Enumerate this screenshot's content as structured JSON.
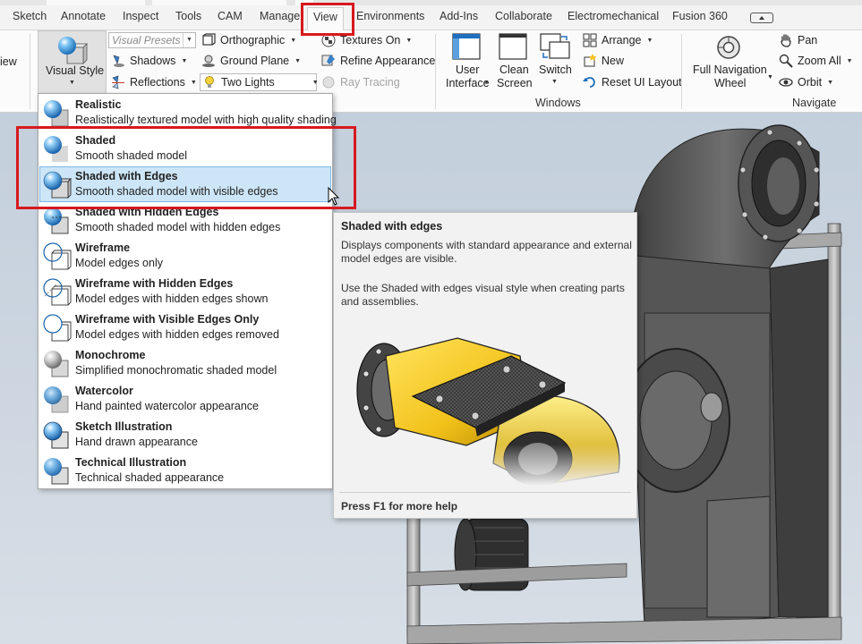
{
  "tabs": [
    "Sketch",
    "Annotate",
    "Inspect",
    "Tools",
    "CAM",
    "Manage",
    "View",
    "Environments",
    "Add-Ins",
    "Collaborate",
    "Electromechanical",
    "Fusion 360"
  ],
  "active_tab": "View",
  "ribbon": {
    "cut_left_label": "iew",
    "visual_style_label": "Visual Style",
    "visual_presets_placeholder": "Visual Presets",
    "shadows": "Shadows",
    "reflections": "Reflections",
    "orthographic": "Orthographic",
    "ground_plane": "Ground Plane",
    "two_lights": "Two Lights",
    "textures_on": "Textures On",
    "refine_appearance": "Refine Appearance",
    "ray_tracing": "Ray Tracing",
    "user_interface": [
      "User",
      "Interface"
    ],
    "clean_screen": [
      "Clean",
      "Screen"
    ],
    "switch": "Switch",
    "arrange": "Arrange",
    "new": "New",
    "reset_ui_layout": "Reset UI Layout",
    "windows_panel": "Windows",
    "full_nav_wheel": [
      "Full Navigation",
      "Wheel"
    ],
    "pan": "Pan",
    "zoom_all": "Zoom All",
    "orbit": "Orbit",
    "navigate_panel": "Navigate"
  },
  "visual_styles": [
    {
      "name": "Realistic",
      "desc": "Realistically textured model with high quality shading",
      "icon": "realistic-icon"
    },
    {
      "name": "Shaded",
      "desc": "Smooth shaded model",
      "icon": "shaded-icon"
    },
    {
      "name": "Shaded with Edges",
      "desc": "Smooth shaded model with visible edges",
      "icon": "shaded-edges-icon"
    },
    {
      "name": "Shaded with Hidden Edges",
      "desc": "Smooth shaded model with hidden edges",
      "icon": "shaded-hidden-edges-icon"
    },
    {
      "name": "Wireframe",
      "desc": "Model edges only",
      "icon": "wireframe-icon"
    },
    {
      "name": "Wireframe with Hidden Edges",
      "desc": "Model edges with hidden edges shown",
      "icon": "wireframe-hidden-icon"
    },
    {
      "name": "Wireframe with Visible Edges Only",
      "desc": "Model edges with hidden edges removed",
      "icon": "wireframe-visible-icon"
    },
    {
      "name": "Monochrome",
      "desc": "Simplified monochromatic shaded model",
      "icon": "monochrome-icon"
    },
    {
      "name": "Watercolor",
      "desc": "Hand painted watercolor appearance",
      "icon": "watercolor-icon"
    },
    {
      "name": "Sketch Illustration",
      "desc": "Hand drawn appearance",
      "icon": "sketch-illustration-icon"
    },
    {
      "name": "Technical Illustration",
      "desc": "Technical shaded appearance",
      "icon": "technical-illustration-icon"
    }
  ],
  "selected_style": "Shaded with Edges",
  "tooltip": {
    "title": "Shaded with edges",
    "line1": "Displays components with standard appearance and external model edges are visible.",
    "line2": "Use the Shaded with edges visual style when creating parts and assemblies.",
    "help": "Press F1 for more help"
  },
  "colors": {
    "highlight_red": "#d7191f",
    "selection_blue": "#cde6f7",
    "part_yellow": "#f2c21b"
  }
}
